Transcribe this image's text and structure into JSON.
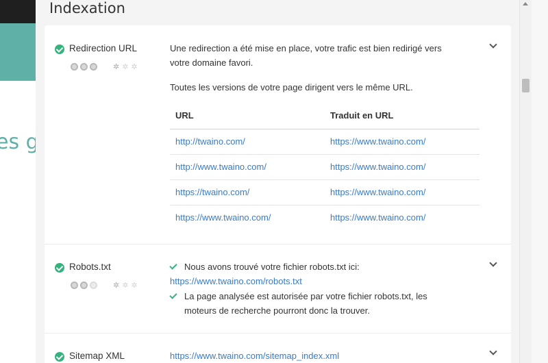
{
  "background": {
    "partial_text": "es g"
  },
  "modal": {
    "title": "Indexation"
  },
  "redirection": {
    "label": "Redirection URL",
    "description_line1": "Une redirection a été mise en place, votre trafic est bien redirigé vers",
    "description_line2": "votre domaine favori.",
    "summary": "Toutes les versions de votre page dirigent vers le même URL.",
    "table": {
      "headers": [
        "URL",
        "Traduit en URL"
      ],
      "rows": [
        [
          "http://twaino.com/",
          "https://www.twaino.com/"
        ],
        [
          "http://www.twaino.com/",
          "https://www.twaino.com/"
        ],
        [
          "https://twaino.com/",
          "https://www.twaino.com/"
        ],
        [
          "https://www.twaino.com/",
          "https://www.twaino.com/"
        ]
      ]
    }
  },
  "robots": {
    "label": "Robots.txt",
    "found_text": "Nous avons trouvé votre fichier robots.txt ici:",
    "found_link": "https://www.twaino.com/robots.txt",
    "allowed_line1": "La page analysée est autorisée par votre fichier robots.txt, les",
    "allowed_line2": "moteurs de recherche pourront donc la trouver."
  },
  "sitemap": {
    "label": "Sitemap XML",
    "link": "https://www.twaino.com/sitemap_index.xml"
  },
  "colors": {
    "success": "#35b37e",
    "link": "#3b7bc0",
    "accent": "#5fb1a8"
  }
}
